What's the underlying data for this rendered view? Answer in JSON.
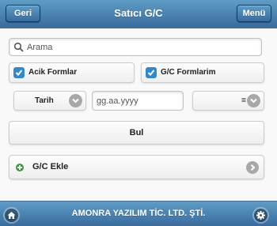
{
  "header": {
    "title": "Satıcı G/C",
    "back_label": "Geri",
    "menu_label": "Menü"
  },
  "search": {
    "placeholder": "Arama",
    "value": ""
  },
  "filters": {
    "open_forms": {
      "label": "Acik Formlar",
      "checked": true
    },
    "my_forms": {
      "label": "G/C Formlarim",
      "checked": true
    }
  },
  "date_filter": {
    "field_select": "Tarih",
    "date_placeholder": "gg.aa.yyyy",
    "operator_select": "="
  },
  "actions": {
    "find_label": "Bul",
    "add_label": "G/C Ekle"
  },
  "footer": {
    "title": "AMONRA YAZILIM TİC. LTD. ŞTİ."
  },
  "colors": {
    "header_top": "#5f9cc5",
    "header_bottom": "#396b9e",
    "checkbox": "#3388cc",
    "add_icon": "#3a9a3a"
  }
}
